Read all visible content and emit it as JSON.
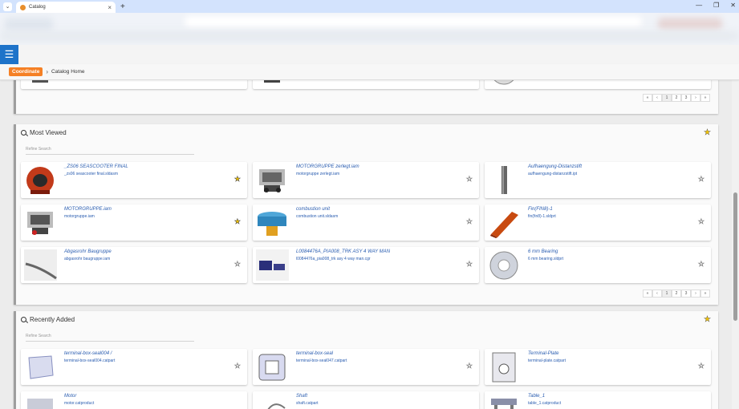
{
  "browser": {
    "tab_title": "Catalog",
    "tab_close": "×",
    "new_tab": "+",
    "menu_icon": "chevron-down-icon",
    "window_controls": [
      "—",
      "❐",
      "✕"
    ]
  },
  "app": {
    "menu_icon": "☰",
    "breadcrumb": {
      "root": "Coordinate",
      "separator": "›",
      "current": "Catalog Home"
    },
    "accent_color": "#1e73c9",
    "brand_color": "#f58025"
  },
  "top_pager": [
    "«",
    "‹",
    "1",
    "2",
    "3",
    "›",
    "»"
  ],
  "most_viewed": {
    "title": "Most Viewed",
    "refine_placeholder": "Refine Search",
    "pager": [
      "«",
      "‹",
      "1",
      "2",
      "3",
      "›",
      "»"
    ],
    "items": [
      {
        "title": "_ZS06 SEASCOOTER FINAL",
        "file": "_zs06 seascooter final.sldasm",
        "favorite": true,
        "thumb": "helmet"
      },
      {
        "title": "MOTORGRUPPE zerlegt.iam",
        "file": "motorgruppe zerlegt.iam",
        "favorite": false,
        "thumb": "engine"
      },
      {
        "title": "Aufhaengung-Distanzstift",
        "file": "aufhaengung-distanzstift.ipt",
        "favorite": false,
        "thumb": "rod"
      },
      {
        "title": "MOTORGRUPPE.iam",
        "file": "motorgruppe.iam",
        "favorite": true,
        "thumb": "engine"
      },
      {
        "title": "combustion unit",
        "file": "combustion unit.sldasm",
        "favorite": false,
        "thumb": "cyl"
      },
      {
        "title": "Fin(FIN8)-1",
        "file": "fin(fin8)-1.sldprt",
        "favorite": false,
        "thumb": "fin"
      },
      {
        "title": "Abgasrohr Baugruppe",
        "file": "abgasrohr baugruppe.iam",
        "favorite": false,
        "thumb": "pipe"
      },
      {
        "title": "L0084476A_PIA008_TRK ASY 4 WAY MAN",
        "file": "l0084476a_pia008_trk asy 4 way man.cgr",
        "favorite": false,
        "thumb": "truck"
      },
      {
        "title": "6 mm Bearing",
        "file": "6 mm bearing.sldprt",
        "favorite": false,
        "thumb": "bearing"
      }
    ]
  },
  "recently_added": {
    "title": "Recently Added",
    "refine_placeholder": "Refine Search",
    "items": [
      {
        "title": "terminal-box-seal004 /",
        "file": "terminal-box-seal004.catpart",
        "favorite": false,
        "thumb": "seal"
      },
      {
        "title": "terminal-box-seal",
        "file": "terminal-box-seal047.catpart",
        "favorite": false,
        "thumb": "box"
      },
      {
        "title": "Terminal-Plate",
        "file": "terminal-plate.catpart",
        "favorite": false,
        "thumb": "plate"
      },
      {
        "title": "Motor",
        "file": "motor.catproduct",
        "favorite": false,
        "thumb": "motor"
      },
      {
        "title": "Shaft",
        "file": "shaft.catpart",
        "favorite": false,
        "thumb": "shaft"
      },
      {
        "title": "Table_1",
        "file": "table_1.catproduct",
        "favorite": false,
        "thumb": "table"
      }
    ]
  },
  "icons": {
    "star": "★",
    "search": "search-icon",
    "favorite_color": "#f2c200"
  }
}
